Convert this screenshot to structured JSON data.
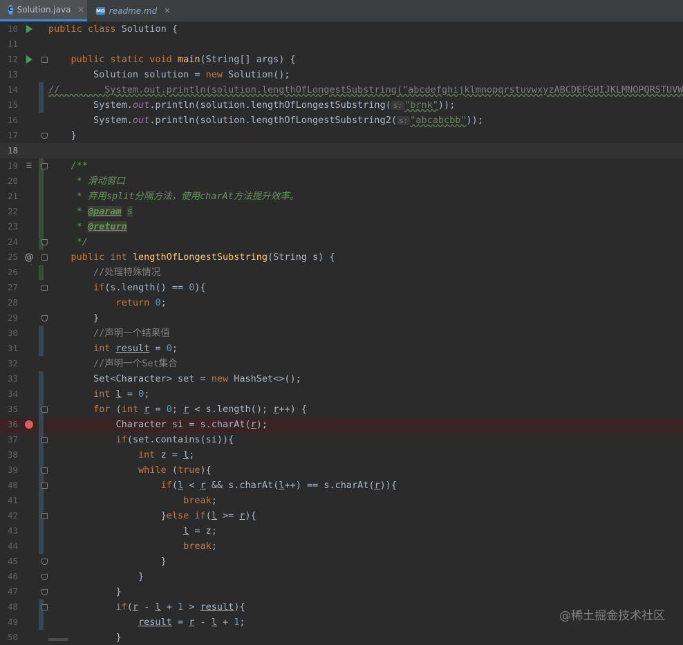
{
  "tabs": [
    {
      "label": "Solution.java",
      "icon": "java-class-icon",
      "active": true
    },
    {
      "label": "readme.md",
      "icon": "markdown-file-icon",
      "active": false
    }
  ],
  "watermark": "@稀土掘金技术社区",
  "line_numbers": [
    "10",
    "11",
    "12",
    "13",
    "14",
    "15",
    "16",
    "17",
    "18",
    "19",
    "20",
    "21",
    "22",
    "23",
    "24",
    "25",
    "26",
    "27",
    "28",
    "29",
    "30",
    "31",
    "32",
    "33",
    "34",
    "35",
    "36",
    "37",
    "38",
    "39",
    "40",
    "41",
    "42",
    "43",
    "44",
    "45",
    "46",
    "47",
    "48",
    "49",
    "50"
  ],
  "code": {
    "l10": {
      "kw": "public class ",
      "name": "Solution {"
    },
    "l12": {
      "kw": "public static void ",
      "fn": "main",
      "rest": "(String[] args) {"
    },
    "l13": {
      "a": "Solution solution = ",
      "kw": "new ",
      "b": "Solution();"
    },
    "l14": {
      "comment": "//        System.out.println(solution.lengthOfLongestSubstring(\"abcdefghijklmnopqrstuvwxyzABCDEFGHIJKLMNOPQRSTUVWXY"
    },
    "l15": {
      "a": "System.",
      "out": "out",
      "b": ".println(solution.lengthOfLongestSubstring(",
      "hint": "s:",
      "str": "\"brnk\"",
      "c": "));"
    },
    "l16": {
      "a": "System.",
      "out": "out",
      "b": ".println(solution.lengthOfLongestSubstring2(",
      "hint": "s:",
      "str": "\"abcabcbb\"",
      "c": "));"
    },
    "l17": {
      "a": "}"
    },
    "l19": {
      "doc": "/**"
    },
    "l20": {
      "doc": " * 滑动窗口"
    },
    "l21": {
      "doc": " * 弃用split分隔方法，使用charAt方法提升效率。"
    },
    "l22": {
      "doc": " * ",
      "tag": "@param",
      "param": "s"
    },
    "l23": {
      "doc": " * ",
      "tag": "@return"
    },
    "l24": {
      "doc": " */"
    },
    "l25": {
      "kw": "public int ",
      "fn": "lengthOfLongestSubstring",
      "rest": "(String s) {"
    },
    "l26": {
      "comment": "//处理特殊情况"
    },
    "l27": {
      "kw": "if",
      "a": "(s.length() == ",
      "n": "0",
      "b": "){"
    },
    "l28": {
      "kw": "return ",
      "n": "0",
      "b": ";"
    },
    "l29": {
      "a": "}"
    },
    "l30": {
      "comment": "//声明一个结果值"
    },
    "l31": {
      "kw": "int ",
      "v": "result",
      "a": " = ",
      "n": "0",
      "b": ";"
    },
    "l32": {
      "comment": "//声明一个Set集合"
    },
    "l33": {
      "a": "Set<Character> set = ",
      "kw": "new ",
      "b": "HashSet<>();"
    },
    "l34": {
      "kw": "int ",
      "v": "l",
      "a": " = ",
      "n": "0",
      "b": ";"
    },
    "l35": {
      "kw": "for ",
      "a": "(",
      "kw2": "int ",
      "v": "r",
      "b": " = ",
      "n": "0",
      "c": "; ",
      "v2": "r",
      "d": " < s.length(); ",
      "v3": "r",
      "e": "++) {"
    },
    "l36": {
      "a": "Character si = s.charAt(",
      "v": "r",
      "b": ");"
    },
    "l37": {
      "kw": "if",
      "a": "(set.contains(si)){"
    },
    "l38": {
      "kw": "int ",
      "a": "z = ",
      "v": "l",
      "b": ";"
    },
    "l39": {
      "kw": "while ",
      "a": "(",
      "kw2": "true",
      "b": "){"
    },
    "l40": {
      "kw": "if",
      "a": "(",
      "v": "l",
      "b": " < ",
      "v2": "r",
      "c": " && s.charAt(",
      "v3": "l",
      "d": "++) == s.charAt(",
      "v4": "r",
      "e": ")){"
    },
    "l41": {
      "kw": "break",
      "a": ";"
    },
    "l42": {
      "a": "}",
      "kw": "else if",
      "b": "(",
      "v": "l",
      "c": " >= ",
      "v2": "r",
      "d": "){"
    },
    "l43": {
      "v": "l",
      "a": " = z;"
    },
    "l44": {
      "kw": "break",
      "a": ";"
    },
    "l45": {
      "a": "}"
    },
    "l46": {
      "a": "}"
    },
    "l47": {
      "a": "}"
    },
    "l48": {
      "kw": "if",
      "a": "(",
      "v": "r",
      "b": " - ",
      "v2": "l",
      "c": " + ",
      "n": "1",
      "d": " > ",
      "v3": "result",
      "e": "){"
    },
    "l49": {
      "v": "result",
      "a": " = ",
      "v2": "r",
      "b": " - ",
      "v3": "l",
      "c": " + ",
      "n": "1",
      "d": ";"
    },
    "l50": {
      "a": "}"
    }
  },
  "colors": {
    "background": "#2b2b2b",
    "keyword": "#cc7832",
    "function": "#ffc66d",
    "number": "#6897bb",
    "string": "#6a8759",
    "comment": "#808080",
    "doc_comment": "#629755",
    "breakpoint": "#db5c5c",
    "run_icon": "#499c54"
  }
}
